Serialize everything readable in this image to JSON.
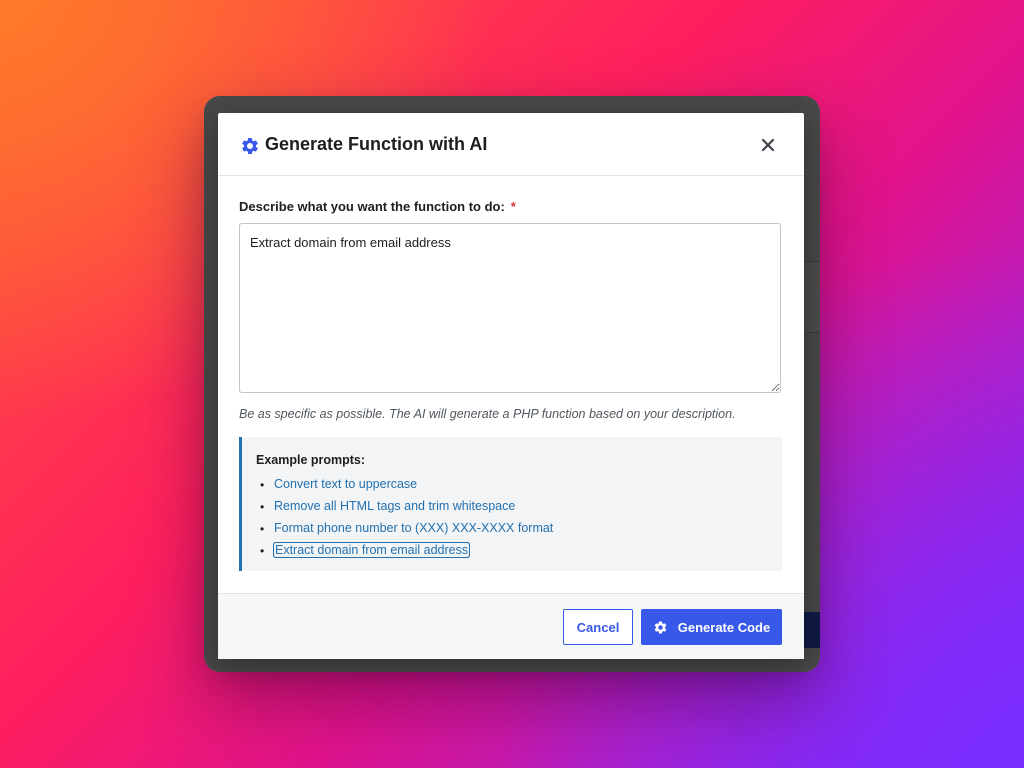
{
  "modal": {
    "title": "Generate Function with AI",
    "close_symbol": "×",
    "title_icon": "gear-icon"
  },
  "form": {
    "label": "Describe what you want the function to do:",
    "required_marker": "*",
    "textarea_value": "Extract domain from email address",
    "help_text": "Be as specific as possible. The AI will generate a PHP function based on your description."
  },
  "examples": {
    "title": "Example prompts:",
    "items": [
      {
        "label": "Convert text to uppercase"
      },
      {
        "label": "Remove all HTML tags and trim whitespace"
      },
      {
        "label": "Format phone number to (XXX) XXX-XXXX format"
      },
      {
        "label": "Extract domain from email address",
        "focused": true
      }
    ]
  },
  "footer": {
    "cancel_label": "Cancel",
    "generate_label": "Generate Code",
    "generate_icon": "gear-icon"
  },
  "colors": {
    "primary": "#3858e9",
    "link": "#2271b1",
    "required": "#d63638"
  }
}
